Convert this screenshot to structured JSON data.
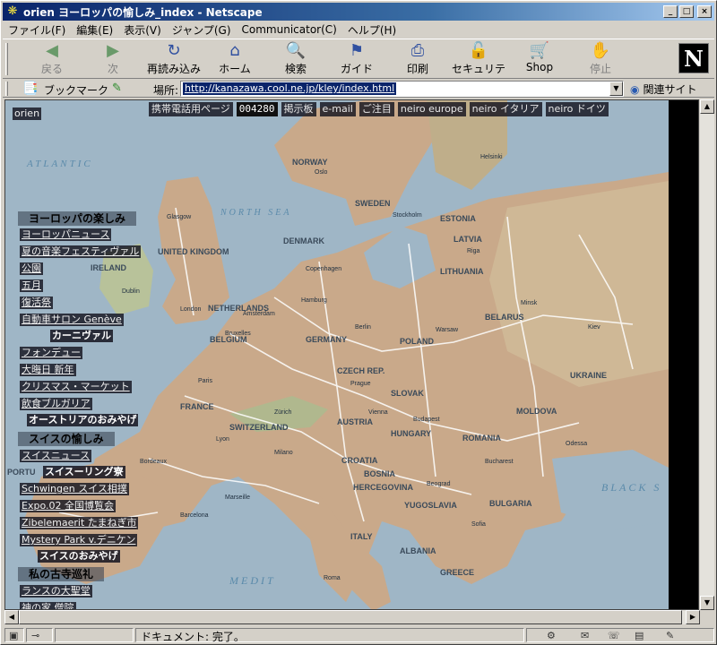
{
  "window": {
    "title": "orien ヨーロッパの愉しみ_index - Netscape",
    "controls": {
      "minimize": "_",
      "maximize": "□",
      "close": "×"
    }
  },
  "menu": [
    "ファイル(F)",
    "編集(E)",
    "表示(V)",
    "ジャンプ(G)",
    "Communicator(C)",
    "ヘルプ(H)"
  ],
  "toolbar": {
    "buttons": [
      {
        "label": "戻る",
        "icon": "back-arrow-icon"
      },
      {
        "label": "次",
        "icon": "forward-arrow-icon"
      },
      {
        "label": "再読み込み",
        "icon": "reload-icon"
      },
      {
        "label": "ホーム",
        "icon": "home-icon"
      },
      {
        "label": "検索",
        "icon": "search-icon"
      },
      {
        "label": "ガイド",
        "icon": "guide-icon"
      },
      {
        "label": "印刷",
        "icon": "print-icon"
      },
      {
        "label": "セキュリティ",
        "icon": "lock-icon"
      },
      {
        "label": "Shop",
        "icon": "shop-icon"
      },
      {
        "label": "停止",
        "icon": "stop-icon"
      }
    ],
    "logo": "N"
  },
  "location": {
    "bookmarks_label": "ブックマーク",
    "location_label": "場所:",
    "url": "http://kanazawa.cool.ne.jp/kley/index.html",
    "related_label": "関連サイト"
  },
  "page": {
    "site_name": "orien",
    "top_links": [
      "携帯電話用ページ",
      "004280",
      "掲示板",
      "e-mail",
      "ご注目",
      "neiro europe",
      "neiro イタリア",
      "neiro ドイツ"
    ],
    "section1": {
      "heading": "ヨーロッパの楽しみ",
      "links": [
        "ヨーロッパニュース",
        "夏の音楽フェスティヴァル",
        "公園",
        "五月",
        "復活祭",
        "自動車サロン Genève",
        "カーニヴァル",
        "フォンデュー",
        "大晦日 新年",
        "クリスマス・マーケット",
        "飲食ブルガリア",
        "オーストリアのおみやげ"
      ]
    },
    "section2": {
      "heading": "スイスの愉しみ",
      "links": [
        "スイスニュース",
        "スイスーリング寮",
        "Schwingen スイス相撲",
        "Expo.02 全国博覧会",
        "Zibelemaerit たまねぎ市",
        "Mystery Park v.デニケン",
        "スイスのおみやげ"
      ]
    },
    "section3": {
      "heading": "私の古寺巡礼",
      "links": [
        "ランスの大聖堂",
        "神の家 僧院"
      ]
    },
    "map_labels": {
      "seas": [
        "ATLANTIC",
        "NORTH SEA",
        "BLACK S",
        "MEDIT"
      ],
      "countries": [
        "NORWAY",
        "SWEDEN",
        "ESTONIA",
        "LATVIA",
        "DENMARK",
        "UNITED KINGDOM",
        "IRELAND",
        "LITHUANIA",
        "NETHERLANDS",
        "BELARUS",
        "BELGIUM",
        "GERMANY",
        "POLAND",
        "CZECH REP.",
        "UKRAINE",
        "FRANCE",
        "SLOVAK",
        "MOLDOVA",
        "AUSTRIA",
        "SWITZERLAND",
        "HUNGARY",
        "ROMANIA",
        "CROATIA",
        "BOSNIA",
        "HERCEGOVINA",
        "YUGOSLAVIA",
        "BULGARIA",
        "ITALY",
        "ALBANIA",
        "GREECE",
        "PORTU"
      ],
      "cities": [
        "Oslo",
        "Stockholm",
        "Riga",
        "Minsk",
        "Warsaw",
        "Berlin",
        "Prague",
        "Vienna",
        "Budapest",
        "Bucharest",
        "Paris",
        "London",
        "Dublin",
        "Glasgow",
        "Lyon",
        "Milano",
        "Roma",
        "Sofia",
        "Beograd",
        "Kiev",
        "Copenhagen",
        "Amsterdam",
        "Bruxelles",
        "Zürich",
        "Marseille",
        "Barcelona",
        "Bordeaux",
        "Hamburg",
        "Helsinki",
        "Odessa"
      ]
    }
  },
  "status": {
    "text": "ドキュメント: 完了。"
  },
  "colors": {
    "title_start": "#0a246a",
    "title_end": "#a6caf0",
    "chrome": "#d4d0c8",
    "url_selection": "#0a246a",
    "map_sea": "#9fb6c6",
    "map_land": "#c9a98a"
  }
}
